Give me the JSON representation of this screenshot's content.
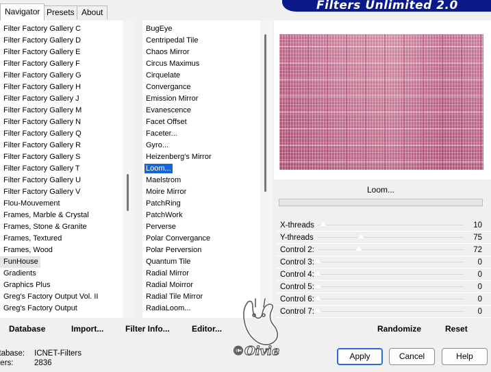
{
  "tabs": [
    "Navigator",
    "Presets",
    "About"
  ],
  "banner": {
    "title": "Filters Unlimited 2.0"
  },
  "categories": [
    "Filter Factory Gallery C",
    "Filter Factory Gallery D",
    "Filter Factory Gallery E",
    "Filter Factory Gallery F",
    "Filter Factory Gallery G",
    "Filter Factory Gallery H",
    "Filter Factory Gallery J",
    "Filter Factory Gallery M",
    "Filter Factory Gallery N",
    "Filter Factory Gallery Q",
    "Filter Factory Gallery R",
    "Filter Factory Gallery S",
    "Filter Factory Gallery T",
    "Filter Factory Gallery U",
    "Filter Factory Gallery V",
    "Flou-Mouvement",
    "Frames, Marble & Crystal",
    "Frames, Stone & Granite",
    "Frames, Textured",
    "Frames, Wood",
    "FunHouse",
    "Gradients",
    "Graphics Plus",
    "Greg's Factory Output Vol. II",
    "Greg's Factory Output"
  ],
  "categories_highlight_index": 20,
  "filters": [
    "BugEye",
    "Centripedal Tile",
    "Chaos Mirror",
    "Circus Maximus",
    "Cirquelate",
    "Convergance",
    "Emission Mirror",
    "Evanescence",
    "Facet Offset",
    "Faceter...",
    "Gyro...",
    "Heizenberg's Mirror",
    "Loom...",
    "Maelstrom",
    "Moire Mirror",
    "PatchRing",
    "PatchWork",
    "Perverse",
    "Polar Convergance",
    "Polar Perversion",
    "Quantum Tile",
    "Radial Mirror",
    "Radial Moirror",
    "Radial Tile Mirror",
    "RadiaLoom..."
  ],
  "filters_selected_index": 12,
  "preview": {
    "filter_name": "Loom...",
    "colors": {
      "base": "#e6a8c0",
      "stripe": "#b03c6e"
    }
  },
  "controls": [
    {
      "label": "X-threads",
      "value": "10",
      "level": 10
    },
    {
      "label": "Y-threads",
      "value": "75",
      "level": 75
    },
    {
      "label": "Control 2:",
      "value": "72",
      "level": 72
    },
    {
      "label": "Control 3:",
      "value": "0",
      "level": 0
    },
    {
      "label": "Control 4:",
      "value": "0",
      "level": 0
    },
    {
      "label": "Control 5:",
      "value": "0",
      "level": 0
    },
    {
      "label": "Control 6:",
      "value": "0",
      "level": 0
    },
    {
      "label": "Control 7:",
      "value": "0",
      "level": 0
    }
  ],
  "bottom": {
    "database": "Database",
    "import": "Import...",
    "filter_info": "Filter Info...",
    "editor": "Editor...",
    "randomize": "Randomize",
    "reset": "Reset"
  },
  "info": {
    "database_label": "atabase:",
    "database_value": "ICNET-Filters",
    "filters_label": "ilters:",
    "filters_value": "2836"
  },
  "buttons": {
    "apply": "Apply",
    "cancel": "Cancel",
    "help": "Help"
  },
  "watermark": {
    "text": "©Oivie"
  }
}
